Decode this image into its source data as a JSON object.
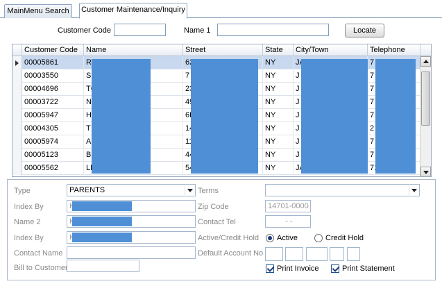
{
  "tabs": [
    {
      "label": "MainMenu Search"
    },
    {
      "label": "Customer Maintenance/Inquiry"
    }
  ],
  "search": {
    "customer_code_label": "Customer Code",
    "customer_code_value": "",
    "name1_label": "Name 1",
    "name1_value": "",
    "locate_label": "Locate"
  },
  "grid": {
    "columns": [
      "Customer Code",
      "Name",
      "Street",
      "State",
      "City/Town",
      "Telephone"
    ],
    "rows": [
      {
        "code": "00005861",
        "name": "R",
        "street": "62",
        "state": "NY",
        "city": "JA",
        "tel": "7"
      },
      {
        "code": "00003550",
        "name": "S",
        "street": "7",
        "state": "NY",
        "city": "J",
        "tel": "7"
      },
      {
        "code": "00004696",
        "name": "TC",
        "street": "23",
        "state": "NY",
        "city": "J",
        "tel": "7"
      },
      {
        "code": "00003722",
        "name": "N",
        "street": "49",
        "state": "NY",
        "city": "J",
        "tel": "7"
      },
      {
        "code": "00005947",
        "name": "H",
        "street": "6L",
        "state": "NY",
        "city": "J",
        "tel": "7"
      },
      {
        "code": "00004305",
        "name": "T",
        "street": "14",
        "state": "NY",
        "city": "J",
        "tel": "2"
      },
      {
        "code": "00005974",
        "name": "A",
        "street": "11",
        "state": "NY",
        "city": "J",
        "tel": "7"
      },
      {
        "code": "00005123",
        "name": "BE",
        "street": "44",
        "state": "NY",
        "city": "J",
        "tel": "7"
      },
      {
        "code": "00005562",
        "name": "LE",
        "street": "54",
        "state": "NY",
        "city": "JA",
        "tel": "7125437667"
      }
    ]
  },
  "detail": {
    "type_label": "Type",
    "type_value": "PARENTS",
    "terms_label": "Terms",
    "terms_value": "",
    "index_by_label": "Index By",
    "index_by_value": "K",
    "zip_label": "Zip Code",
    "zip_value": "14701-0000",
    "name2_label": "Name 2",
    "name2_value": "K",
    "contact_tel_label": "Contact Tel",
    "contact_tel_value": "-   -",
    "index_by2_label": "Index By",
    "index_by2_value": "K",
    "active_credit_label": "Active/Credit Hold",
    "active_label": "Active",
    "credit_hold_label": "Credit Hold",
    "contact_name_label": "Contact Name",
    "contact_name_value": "",
    "default_account_label": "Default Account No",
    "bill_to_label": "Bill to Customer",
    "bill_to_value": "",
    "print_invoice_label": "Print Invoice",
    "print_statement_label": "Print Statement"
  },
  "colors": {
    "redaction": "#4f8fd6",
    "selected_row": "#c7d8ef"
  }
}
